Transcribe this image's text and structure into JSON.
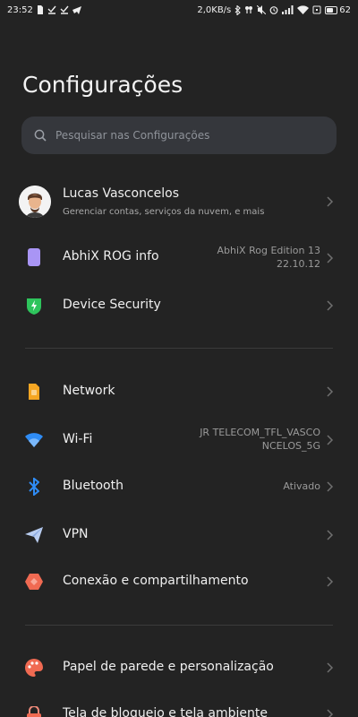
{
  "status_bar": {
    "time": "23:52",
    "speed": "2,0KB/s",
    "battery": "62"
  },
  "page": {
    "title": "Configurações"
  },
  "search": {
    "placeholder": "Pesquisar nas Configurações"
  },
  "profile": {
    "name": "Lucas Vasconcelos",
    "subtitle": "Gerenciar contas, serviços da nuvem, e mais"
  },
  "items": {
    "abhix": {
      "label": "AbhiX ROG info",
      "value_line1": "AbhiX Rog Edition 13",
      "value_line2": "22.10.12"
    },
    "device_security": {
      "label": "Device Security"
    },
    "network": {
      "label": "Network"
    },
    "wifi": {
      "label": "Wi-Fi",
      "value_line1": "JR TELECOM_TFL_VASCO",
      "value_line2": "NCELOS_5G"
    },
    "bluetooth": {
      "label": "Bluetooth",
      "value": "Ativado"
    },
    "vpn": {
      "label": "VPN"
    },
    "connection": {
      "label": "Conexão e compartilhamento"
    },
    "wallpaper": {
      "label": "Papel de parede e personalização"
    },
    "lockscreen": {
      "label": "Tela de bloqueio e tela ambiente"
    }
  },
  "colors": {
    "background": "#232323",
    "search_bg": "#35373c",
    "accent_purple": "#a995f5",
    "accent_green": "#2ec45c",
    "accent_orange": "#f5a623",
    "accent_blue": "#2f8cf5",
    "accent_red": "#f06a52"
  }
}
